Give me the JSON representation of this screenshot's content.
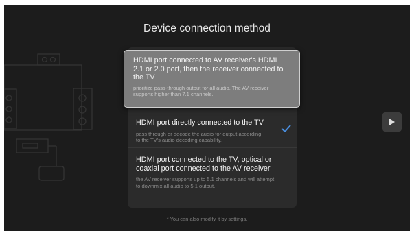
{
  "title": "Device connection method",
  "options": [
    {
      "title": "HDMI port connected to AV receiver's HDMI 2.1 or 2.0 port, then the receiver connected to the TV",
      "description": "prioritize pass-through output for all audio. The AV receiver supports higher than 7.1 channels.",
      "focused": true,
      "selected": false
    },
    {
      "title": "HDMI port directly connected to the TV",
      "description": "pass through or decode the audio for output according to the TV's audio decoding capability.",
      "focused": false,
      "selected": true
    },
    {
      "title": "HDMI port connected to the TV, optical or coaxial port connected to the AV receiver",
      "description": "the AV receiver supports up to 5.1 channels and will attempt to downmix all audio to 5.1 output.",
      "focused": false,
      "selected": false
    }
  ],
  "footer": "* You can also modify it by settings.",
  "icons": {
    "next": "play-icon",
    "selected": "checkmark-icon",
    "illustration": "home-theater-illustration"
  },
  "colors": {
    "background": "#1c1c1c",
    "panel": "#2b2b2b",
    "focused_option": "#7d7d7d",
    "check": "#4a90e2"
  }
}
